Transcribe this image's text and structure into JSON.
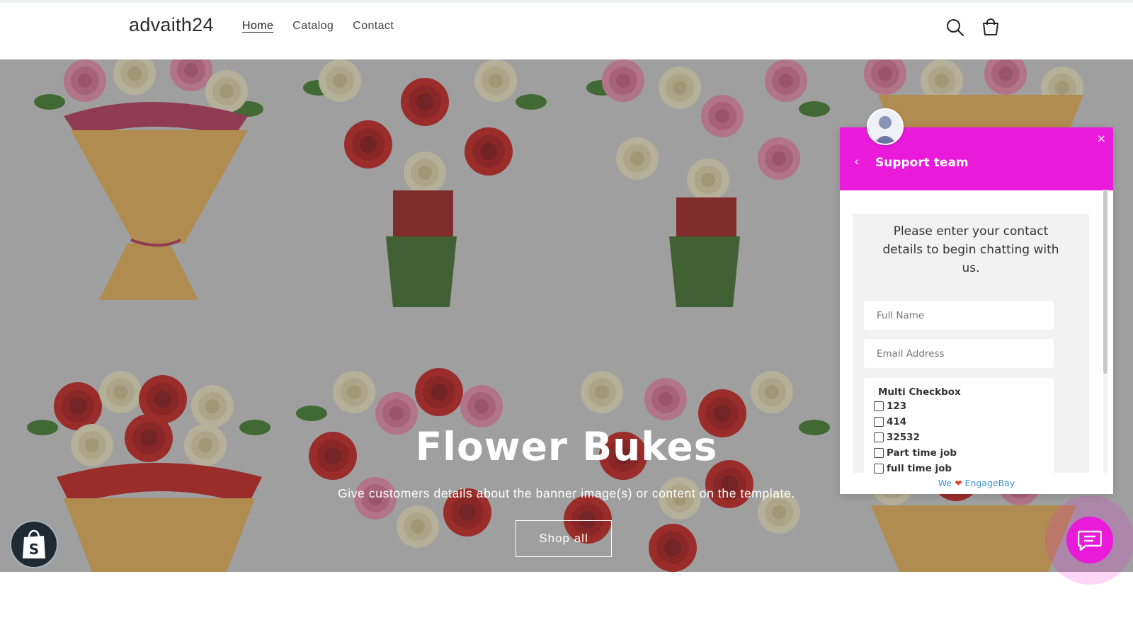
{
  "header": {
    "brand": "advaith24",
    "nav": [
      {
        "label": "Home",
        "active": true
      },
      {
        "label": "Catalog",
        "active": false
      },
      {
        "label": "Contact",
        "active": false
      }
    ],
    "icons": [
      "search-icon",
      "cart-icon"
    ]
  },
  "hero": {
    "title": "Flower Bukes",
    "subtitle": "Give customers details about the banner image(s) or content on the template.",
    "button_label": "Shop all"
  },
  "chat": {
    "title": "Support team",
    "close_label": "×",
    "back_label": "‹",
    "prompt": "Please enter your contact details to begin chatting with us.",
    "fields": {
      "full_name_placeholder": "Full Name",
      "email_placeholder": "Email Address"
    },
    "multi_checkbox": {
      "label": "Multi Checkbox",
      "options": [
        "123",
        "414",
        "32532",
        "Part time job",
        "full time job"
      ]
    },
    "powered_prefix": "We",
    "powered_heart": "❤",
    "powered_brand": "EngageBay",
    "accent_color": "#e91ad9"
  },
  "colors": {
    "link": "#3d93d8",
    "heart": "#e8402e",
    "shopify_bubble": "#1f2a33"
  }
}
